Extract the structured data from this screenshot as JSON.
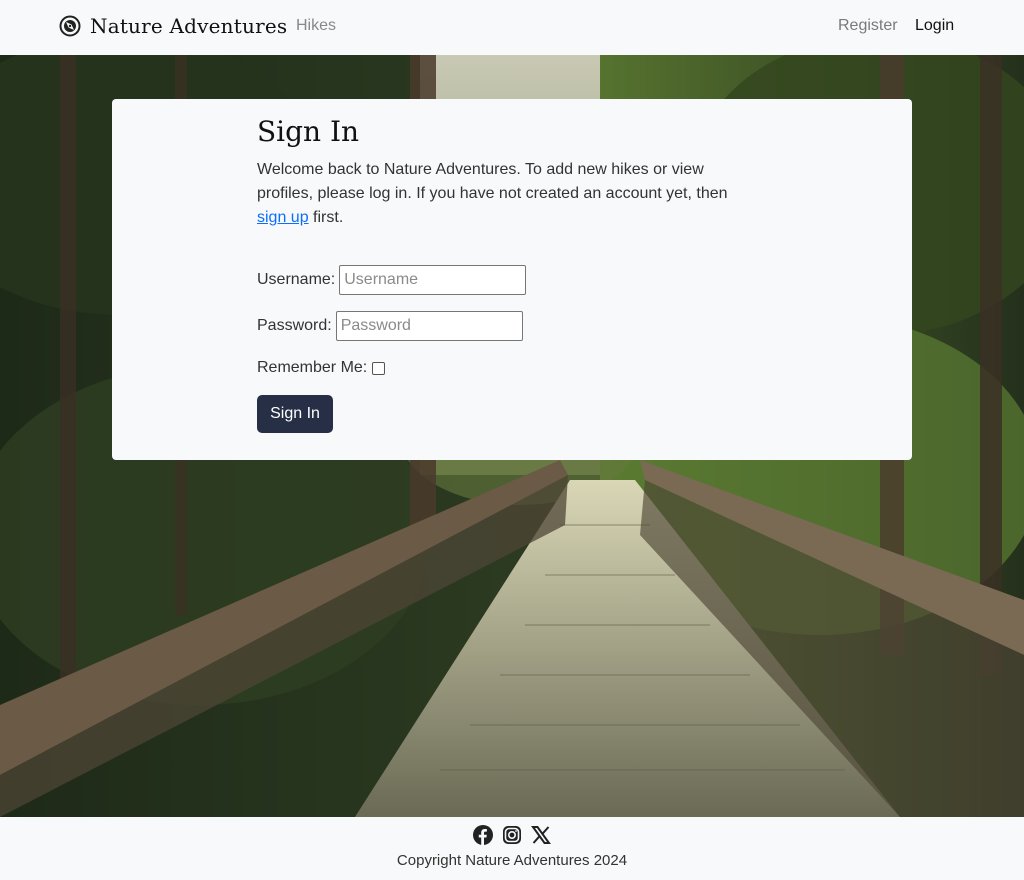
{
  "nav": {
    "brand": "Nature Adventures",
    "hikes": "Hikes",
    "register": "Register",
    "login": "Login"
  },
  "card": {
    "title": "Sign In",
    "intro_before": "Welcome back to Nature Adventures. To add new hikes or view profiles, please log in. If you have not created an account yet, then ",
    "intro_link": "sign up",
    "intro_after": " first.",
    "username_label": "Username:",
    "username_placeholder": "Username",
    "username_value": "",
    "password_label": "Password:",
    "password_placeholder": "Password",
    "password_value": "",
    "remember_label": "Remember Me:",
    "remember_checked": false,
    "submit_label": "Sign In"
  },
  "footer": {
    "icons": [
      "facebook-icon",
      "instagram-icon",
      "x-icon"
    ],
    "copyright": "Copyright Nature Adventures 2024"
  },
  "colors": {
    "button": "#262f45",
    "link": "#0d6efd",
    "background": "#f8f9fa"
  }
}
